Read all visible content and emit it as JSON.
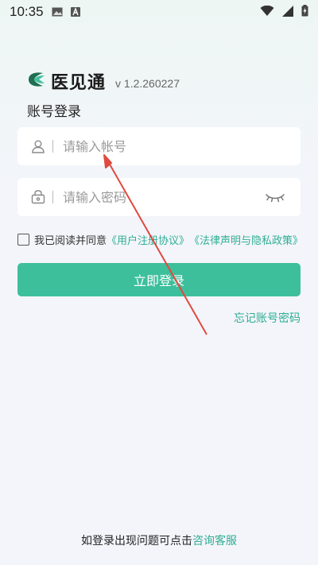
{
  "status_bar": {
    "time": "10:35",
    "icons": [
      "image-icon",
      "a-icon",
      "wifi-icon",
      "signal-icon",
      "battery-charging-icon"
    ]
  },
  "app": {
    "name": "医见通",
    "version": "v 1.2.260227",
    "logo_icon": "leaf-logo-icon"
  },
  "login": {
    "title": "账号登录",
    "account_placeholder": "请输入帐号",
    "password_placeholder": "请输入密码",
    "agree_text": "我已阅读并同意",
    "agreement_link": "《用户注册协议》",
    "privacy_link": "《法律声明与隐私政策》",
    "login_button": "立即登录",
    "forgot_password": "忘记账号密码"
  },
  "footer": {
    "help_text": "如登录出现问题可点击",
    "help_link": "咨询客服"
  },
  "colors": {
    "accent": "#3dbf9c",
    "link": "#2fae94",
    "annotation_arrow": "#e04a3f"
  }
}
